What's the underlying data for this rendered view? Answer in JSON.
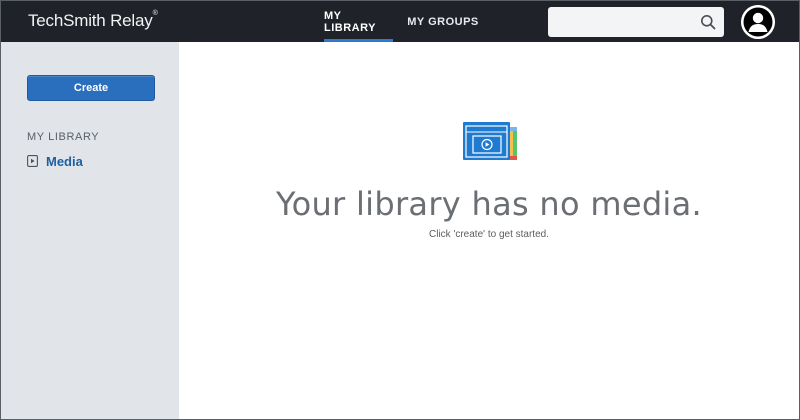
{
  "header": {
    "brand": "TechSmith Relay",
    "brand_mark": "®",
    "tabs": [
      {
        "label": "MY LIBRARY",
        "active": true
      },
      {
        "label": "MY GROUPS",
        "active": false
      }
    ],
    "search": {
      "value": "",
      "placeholder": ""
    },
    "icons": {
      "search": "search-icon",
      "avatar": "user-avatar-icon"
    }
  },
  "sidebar": {
    "create_label": "Create",
    "section_heading": "MY LIBRARY",
    "items": [
      {
        "label": "Media",
        "icon": "media-icon"
      }
    ]
  },
  "main": {
    "empty_title": "Your library has no media.",
    "empty_subtitle": "Click 'create' to get started.",
    "illustration": "empty-library-icon"
  },
  "colors": {
    "topbar": "#1f2329",
    "accent": "#2a6fbd",
    "sidebar_bg": "#e1e4e8",
    "link": "#1f5f9e"
  }
}
